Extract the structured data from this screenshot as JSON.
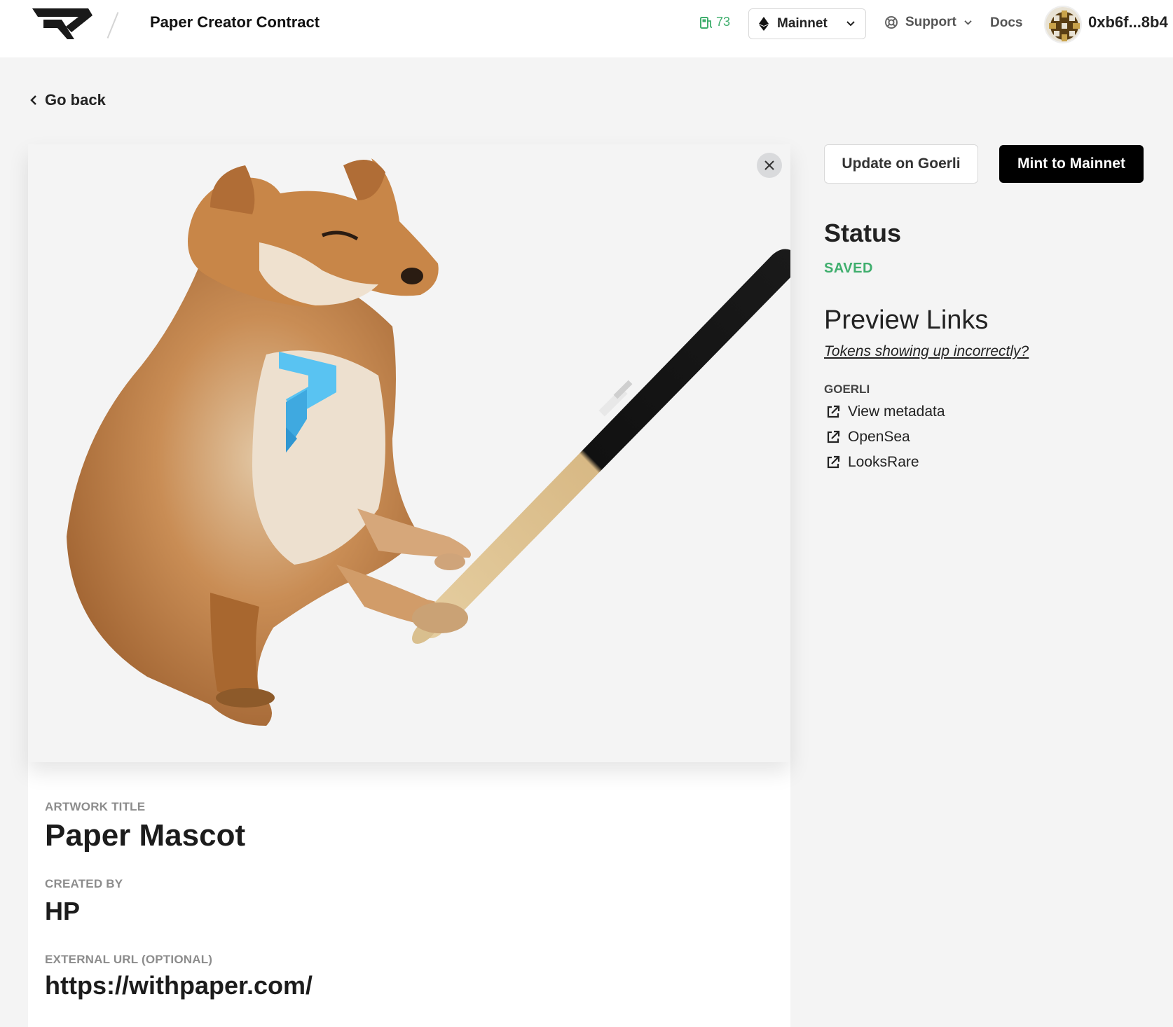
{
  "header": {
    "title": "Paper Creator Contract",
    "gas_value": "73",
    "network": "Mainnet",
    "support_label": "Support",
    "docs_label": "Docs",
    "address": "0xb6f...8b4"
  },
  "nav": {
    "go_back": "Go back"
  },
  "artwork": {
    "title_label": "ARTWORK TITLE",
    "title": "Paper Mascot",
    "creator_label": "CREATED BY",
    "creator": "HP",
    "url_label": "EXTERNAL URL (OPTIONAL)",
    "url": "https://withpaper.com/"
  },
  "actions": {
    "update_label": "Update on Goerli",
    "mint_label": "Mint to Mainnet"
  },
  "status": {
    "heading": "Status",
    "value": "SAVED"
  },
  "preview": {
    "heading": "Preview Links",
    "help_link": "Tokens showing up incorrectly?",
    "network_label": "GOERLI",
    "links": [
      "View metadata",
      "OpenSea",
      "LooksRare"
    ]
  },
  "colors": {
    "accent_green": "#3fae6d",
    "primary_dark": "#000000",
    "background": "#f4f4f4"
  },
  "icons": [
    "paper-logo-icon",
    "gas-pump-icon",
    "ethereum-icon",
    "chevron-down-icon",
    "lifebuoy-icon",
    "chevron-left-icon",
    "close-icon",
    "external-link-icon"
  ]
}
